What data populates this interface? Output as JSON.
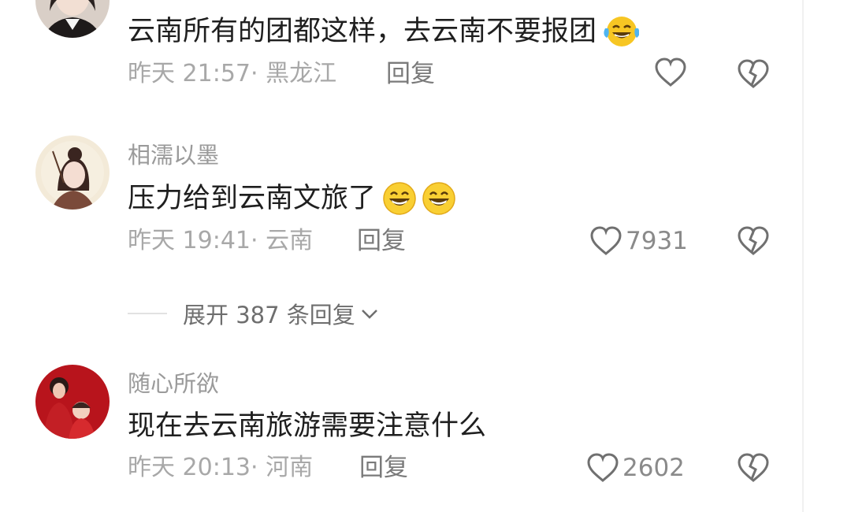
{
  "comments": [
    {
      "username": "",
      "content": "云南所有的团都这样，去云南不要报团",
      "emoji": [
        "laughing-tears-emoji"
      ],
      "meta": "昨天 21:57· 黑龙江",
      "reply": "回复",
      "likes": "",
      "avatar": "woman-portrait-avatar"
    },
    {
      "username": "相濡以墨",
      "content": "压力给到云南文旅了",
      "emoji": [
        "grinning-emoji",
        "grinning-emoji"
      ],
      "meta": "昨天 19:41· 云南",
      "reply": "回复",
      "likes": "7931",
      "avatar": "ancient-style-girl-avatar"
    },
    {
      "username": "随心所欲",
      "content": "现在去云南旅游需要注意什么",
      "emoji": [],
      "meta": "昨天 20:13· 河南",
      "reply": "回复",
      "likes": "2602",
      "avatar": "family-red-avatar"
    }
  ],
  "expand": {
    "label": "展开 387 条回复",
    "icon": "chevron-down-icon"
  },
  "colors": {
    "text_primary": "#1f1f1f",
    "text_meta": "#a8a8a8",
    "text_name": "#9a9a9a",
    "icon_gray": "#707070",
    "background": "#ffffff"
  }
}
